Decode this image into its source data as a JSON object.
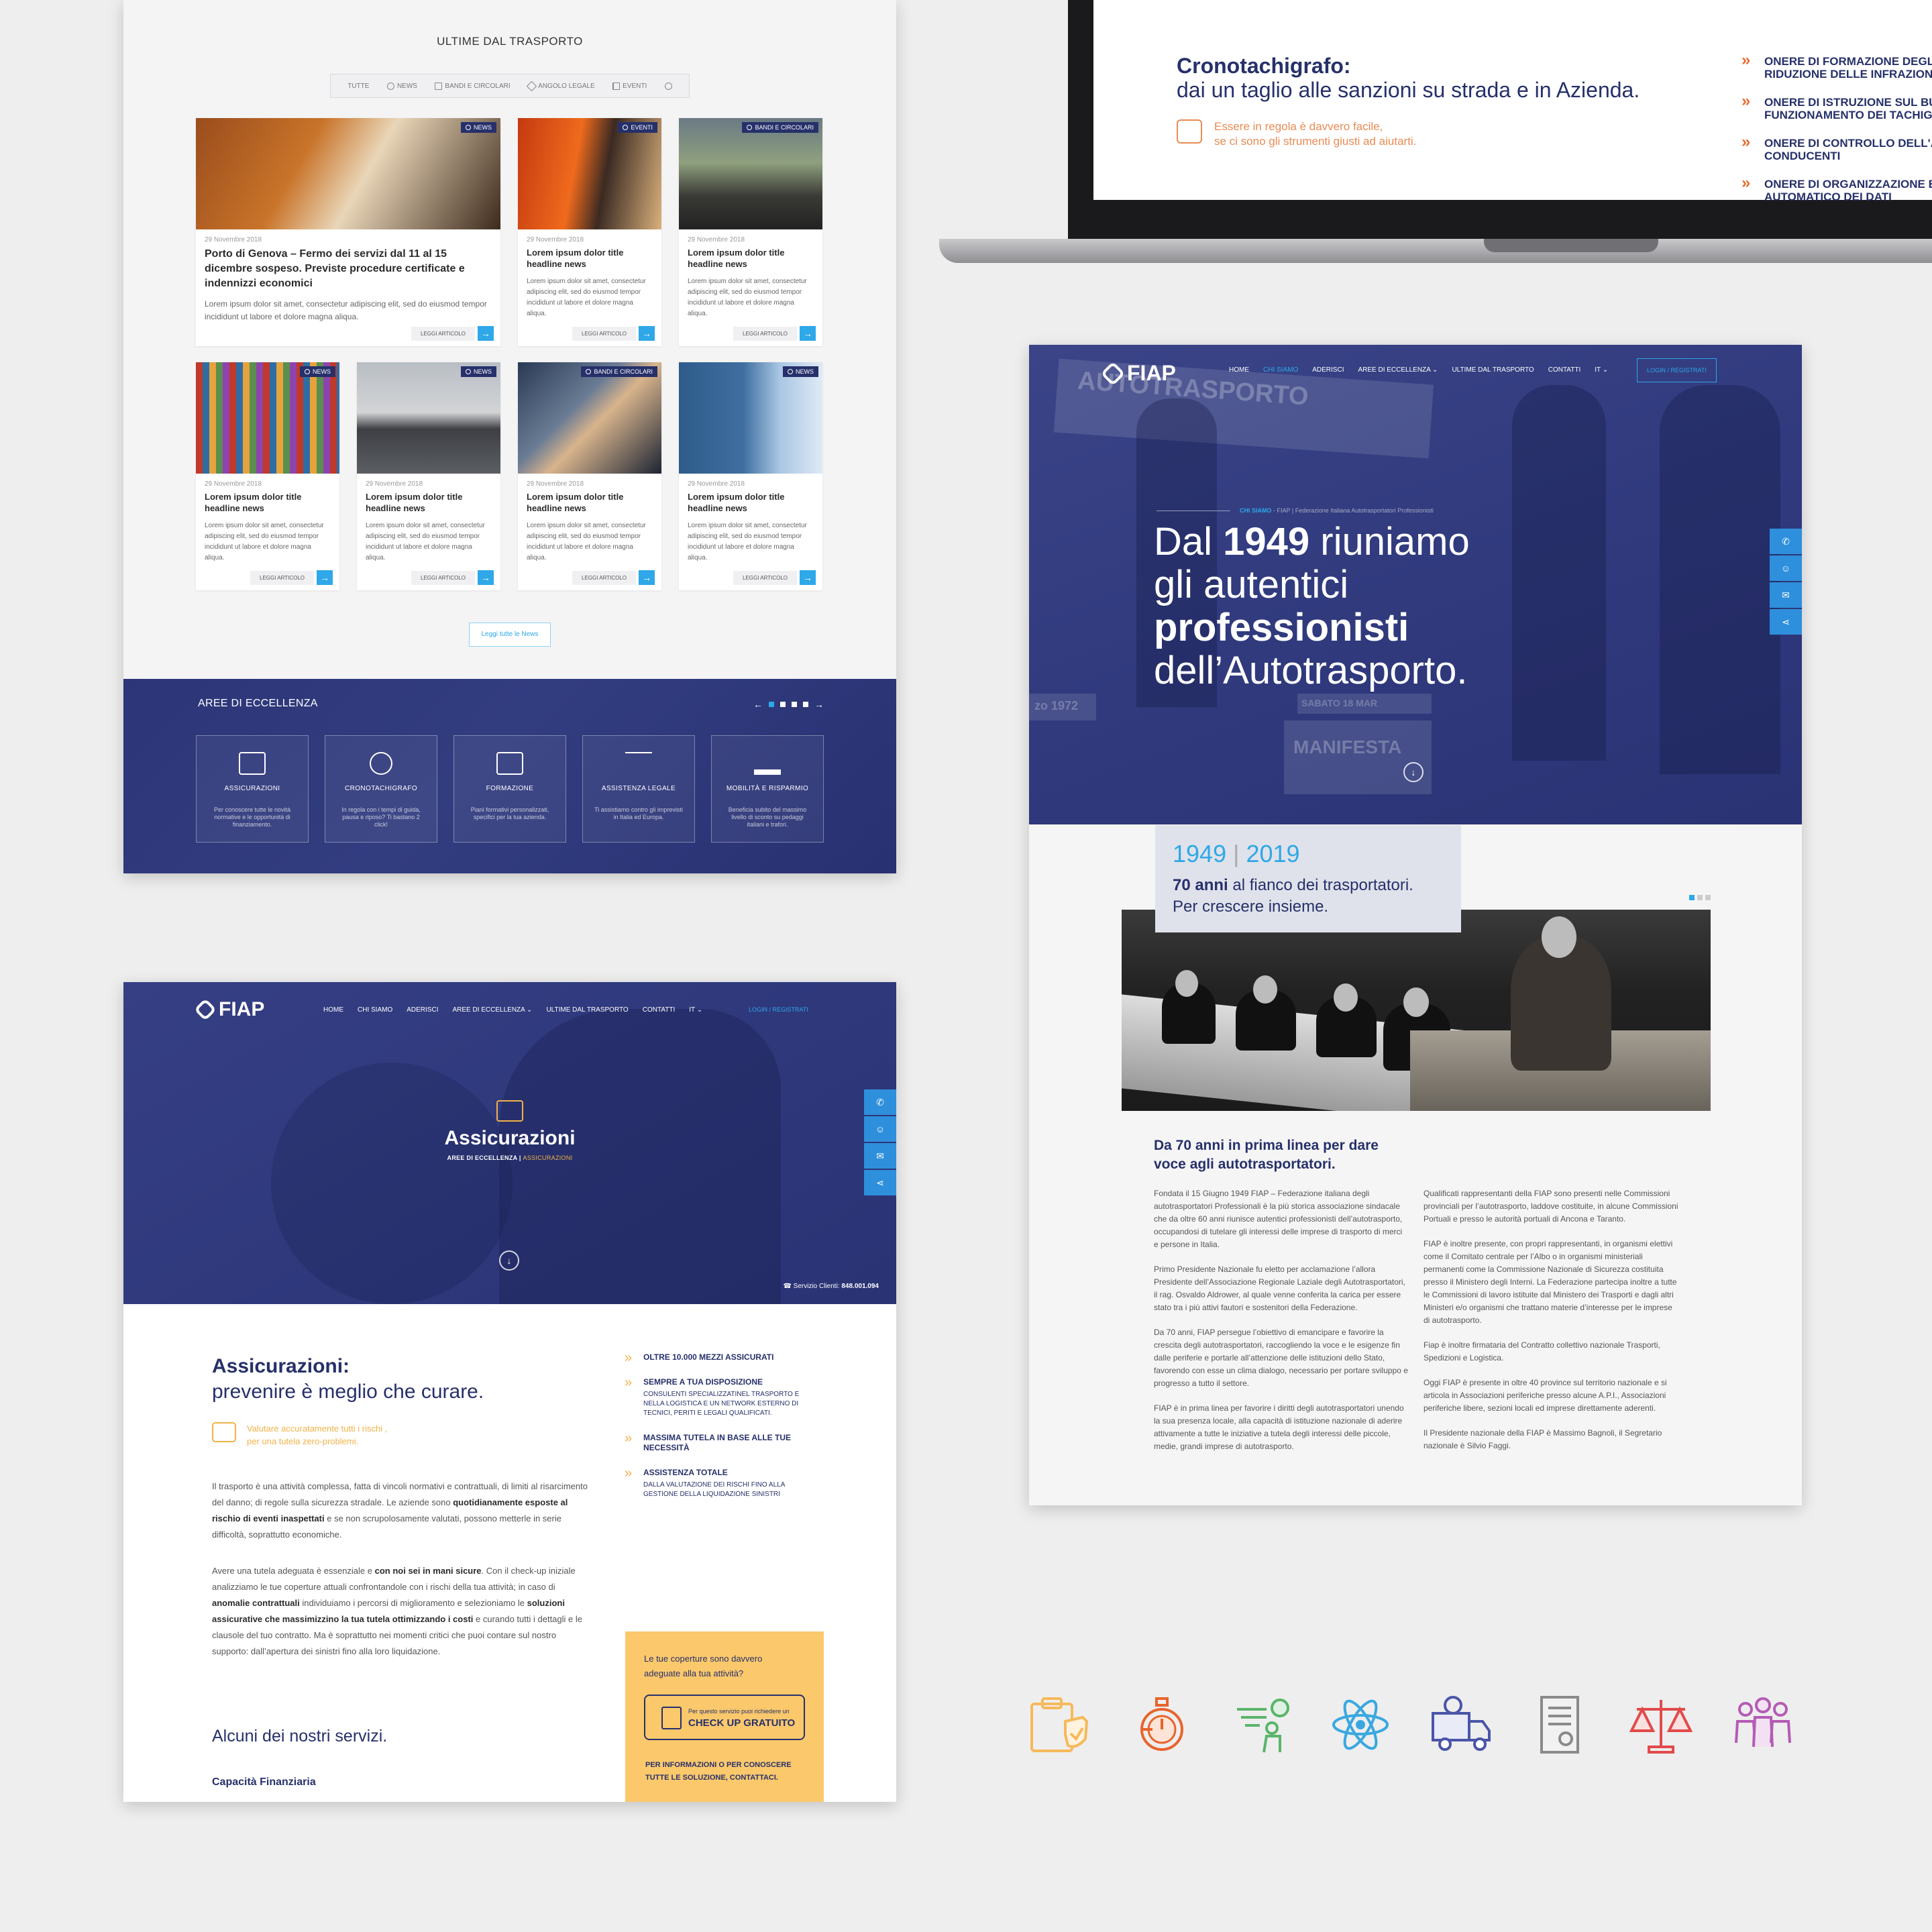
{
  "news": {
    "title": "ULTIME DAL TRASPORTO",
    "filters": [
      "TUTTE",
      "NEWS",
      "BANDI E CIRCOLARI",
      "ANGOLO LEGALE",
      "EVENTI"
    ],
    "cards": [
      {
        "tag": "NEWS",
        "date": "29 Novembre 2018",
        "title": "Porto di Genova – Fermo dei servizi dal 11 al 15 dicembre sospeso. Previste procedure certificate e indennizzi economici",
        "excerpt": "Lorem ipsum dolor sit amet, consectetur adipiscing elit, sed do eiusmod tempor incididunt ut labore et dolore magna aliqua.",
        "read": "LEGGI ARTICOLO"
      },
      {
        "tag": "EVENTI",
        "date": "29 Novembre 2018",
        "title": "Lorem ipsum dolor title headline news",
        "excerpt": "Lorem ipsum dolor sit amet, consectetur adipiscing elit, sed do eiusmod tempor incididunt ut labore et dolore magna aliqua.",
        "read": "LEGGI ARTICOLO"
      },
      {
        "tag": "BANDI E CIRCOLARI",
        "date": "29 Novembre 2018",
        "title": "Lorem ipsum dolor title headline news",
        "excerpt": "Lorem ipsum dolor sit amet, consectetur adipiscing elit, sed do eiusmod tempor incididunt ut labore et dolore magna aliqua.",
        "read": "LEGGI ARTICOLO"
      },
      {
        "tag": "NEWS",
        "date": "29 Novembre 2018",
        "title": "Lorem ipsum dolor title headline news",
        "excerpt": "Lorem ipsum dolor sit amet, consectetur adipiscing elit, sed do eiusmod tempor incididunt ut labore et dolore magna aliqua.",
        "read": "LEGGI ARTICOLO"
      },
      {
        "tag": "NEWS",
        "date": "29 Novembre 2018",
        "title": "Lorem ipsum dolor title headline news",
        "excerpt": "Lorem ipsum dolor sit amet, consectetur adipiscing elit, sed do eiusmod tempor incididunt ut labore et dolore magna aliqua.",
        "read": "LEGGI ARTICOLO"
      },
      {
        "tag": "BANDI E CIRCOLARI",
        "date": "29 Novembre 2018",
        "title": "Lorem ipsum dolor title headline news",
        "excerpt": "Lorem ipsum dolor sit amet, consectetur adipiscing elit, sed do eiusmod tempor incididunt ut labore et dolore magna aliqua.",
        "read": "LEGGI ARTICOLO"
      },
      {
        "tag": "NEWS",
        "date": "29 Novembre 2018",
        "title": "Lorem ipsum dolor title headline news",
        "excerpt": "Lorem ipsum dolor sit amet, consectetur adipiscing elit, sed do eiusmod tempor incididunt ut labore et dolore magna aliqua.",
        "read": "LEGGI ARTICOLO"
      }
    ],
    "all_news": "Leggi tutte le News"
  },
  "aree": {
    "title": "AREE DI ECCELLENZA",
    "prev": "←",
    "next": "→",
    "items": [
      {
        "name": "ASSICURAZIONI",
        "desc": "Per conoscere tutte le novità normative e le opportunità di finanziamento."
      },
      {
        "name": "CRONOTACHIGRAFO",
        "desc": "In regola con i tempi di guida, pausa e riposo? Ti bastano 2 click!"
      },
      {
        "name": "FORMAZIONE",
        "desc": "Piani formativi personalizzati, specifici per la tua azienda."
      },
      {
        "name": "ASSISTENZA LEGALE",
        "desc": "Ti assistiamo contro gli imprevisti in Italia ed Europa."
      },
      {
        "name": "MOBILITÀ E RISPARMIO",
        "desc": "Beneficia subito del massimo livello di sconto su pedaggi italiani e trafori."
      }
    ]
  },
  "crono": {
    "title": "Cronotachigrafo:",
    "subtitle": "dai un taglio alle sanzioni su strada e in Azienda.",
    "note_1": "Essere in regola è davvero facile,",
    "note_2": "se ci sono gli strumenti giusti ad aiutarti.",
    "oneri": [
      {
        "l1": "ONERE DI FORMAZIONE DEGLI A",
        "l2": "RIDUZIONE DELLE INFRAZIONI"
      },
      {
        "l1": "ONERE DI ISTRUZIONE SUL BUO",
        "l2": "FUNZIONAMENTO DEI TACHIGRA"
      },
      {
        "l1": "ONERE DI CONTROLLO DELL'ATT",
        "l2": "CONDUCENTI"
      },
      {
        "l1": "ONERE DI ORGANIZZAZIONE E S",
        "l2": "AUTOMATICO DEI DATI"
      }
    ]
  },
  "nav": {
    "logo": "FIAP",
    "links": [
      "HOME",
      "CHI SIAMO",
      "ADERISCI",
      "AREE DI ECCELLENZA ⌄",
      "ULTIME DAL TRASPORTO",
      "CONTATTI",
      "IT ⌄"
    ],
    "login": "LOGIN / REGISTRATI"
  },
  "chi": {
    "breadcrumb_on": "CHI SIAMO",
    "breadcrumb_rest": " - FIAP | Federazione Italiana Autotrasportatori Professionisti",
    "h_1a": "Dal ",
    "h_1b": "1949",
    "h_1c": " riuniamo",
    "h_2": "gli autentici",
    "h_3": "professionisti",
    "h_4": "dell’Autotrasporto.",
    "banner_1": "AUTOTRASPORTO",
    "banner_2": "MANIFESTA",
    "banner_3": "zo 1972",
    "banner_4": "SABATO 18 MAR",
    "year_a": "1949",
    "year_sep": "|",
    "year_b": "2019",
    "anni_bold": "70 anni",
    "anni_rest": " al fianco dei trasportatori.",
    "anni_2": "Per crescere insieme.",
    "h2_1": "Da 70 anni in prima linea per dare",
    "h2_2": "voce agli autotrasportatori.",
    "col1": [
      "Fondata il 15 Giugno 1949 FIAP – Federazione italiana degli autotrasportatori Professionali è la più storica associazione sindacale che da oltre 60 anni riunisce autentici professionisti dell’autotrasporto, occupandosi di tutelare gli interessi delle imprese di trasporto di merci e persone in Italia.",
      "Primo Presidente Nazionale fu eletto per acclamazione l’allora Presidente dell’Associazione Regionale Laziale degli Autotrasportatori, il rag. Osvaldo Aldrower, al quale venne conferita la carica per essere stato tra i più attivi fautori e sostenitori della Federazione.",
      "Da 70 anni, FIAP persegue l’obiettivo di emancipare e favorire la crescita degli autotrasportatori, raccogliendo la voce e le esigenze fin dalle periferie e portarle all’attenzione delle istituzioni dello Stato, favorendo con esse un clima dialogo, necessario per portare sviluppo e progresso a tutto il settore.",
      "FIAP è in prima linea per favorire i diritti degli autotrasportatori unendo la sua presenza locale, alla capacità di istituzione nazionale di aderire attivamente a tutte le iniziative a tutela degli interessi delle piccole, medie, grandi imprese di autotrasporto."
    ],
    "col2": [
      "Qualificati rappresentanti della FIAP sono presenti nelle Commissioni provinciali per l’autotrasporto, laddove costituite, in alcune Commissioni Portuali e presso le autorità portuali di Ancona e Taranto.",
      "FIAP è inoltre presente, con propri rappresentanti, in organismi elettivi come il Comitato centrale per l’Albo o in organismi ministeriali permanenti come la Commissione Nazionale di Sicurezza costituita presso il Ministero degli Interni. La Federazione partecipa inoltre a tutte le Commissioni di lavoro istituite dal Ministero dei Trasporti e dagli altri Ministeri e/o organismi che trattano materie d’interesse per le imprese di autotrasporto.",
      "Fiap è inoltre firmataria del Contratto collettivo nazionale Trasporti, Spedizioni e Logistica.",
      "Oggi FIAP è presente in oltre 40 province sul territorio nazionale e si articola in Associazioni periferiche presso alcune A.P.I., Associazioni periferiche libere, sezioni locali ed imprese direttamente aderenti.",
      "Il Presidente nazionale della FIAP è Massimo Bagnoli, il Segretario nazionale è Silvio Faggi."
    ]
  },
  "ass": {
    "title": "Assicurazioni",
    "bc_a": "AREE DI ECCELLENZA | ",
    "bc_b": "ASSICURAZIONI",
    "servizio_a": "Servizio Clienti: ",
    "servizio_b": "848.001.094",
    "h2_a": "Assicurazioni:",
    "h2_b": "prevenire è meglio che curare.",
    "note_1": "Valutare accuratamente tutti i rischi ,",
    "note_2": "per una tutela zero-problemi.",
    "p1_a": "Il trasporto è una attività complessa, fatta di vincoli normativi e contrattuali, di limiti al risarcimento del danno; di regole sulla sicurezza stradale. Le aziende sono ",
    "p1_b": "quotidianamente esposte al rischio di eventi inaspettati",
    "p1_c": " e se non scrupolosamente valutati, possono metterle in serie difficoltà, soprattutto economiche.",
    "p2_a": "Avere una tutela adeguata è essenziale e ",
    "p2_b": "con noi sei in mani sicure",
    "p2_c": ". Con il check-up iniziale analizziamo le tue coperture attuali confrontandole con i rischi della tua attività; in caso di ",
    "p2_d": "anomalie contrattuali",
    "p2_e": " individuiamo i percorsi di miglioramento e selezioniamo le ",
    "p2_f": "soluzioni assicurative che massimizzino la tua tutela ottimizzando i costi",
    "p2_g": " e curando tutti i dettagli e le clausole del tuo contratto. Ma è soprattutto nei momenti critici che puoi contare sul nostro supporto: dall’apertura dei sinistri fino alla loro liquidazione.",
    "list": [
      {
        "t": "OLTRE 10.000 MEZZI ASSICURATI",
        "d": ""
      },
      {
        "t": "SEMPRE A TUA DISPOSIZIONE",
        "d": "CONSULENTI SPECIALIZZATINEL TRASPORTO E NELLA LOGISTICA E UN NETWORK ESTERNO DI TECNICI, PERITI E LEGALI QUALIFICATI."
      },
      {
        "t": "MASSIMA TUTELA IN BASE ALLE TUE NECESSITÀ",
        "d": ""
      },
      {
        "t": "ASSISTENZA TOTALE",
        "d": "DALLA VALUTAZIONE DEI RISCHI FINO ALLA GESTIONE DELLA LIQUIDAZIONE SINISTRI"
      }
    ],
    "cta_q1": "Le tue coperture sono davvero",
    "cta_q2": "adeguate alla tua attività?",
    "cta_small": "Per questo servizio puoi richiedere un",
    "cta_big": "CHECK UP GRATUITO",
    "cta_info1": "PER INFORMAZIONI O PER CONOSCERE",
    "cta_info2": "TUTTE LE SOLUZIONE, CONTATTACI.",
    "h3": "Alcuni dei nostri servizi.",
    "h4": "Capacità Finanziaria"
  },
  "colors": {
    "navy": "#26306a",
    "blue": "#2ea8e8",
    "orange": "#e96c2f",
    "yellow": "#fbc86c"
  },
  "icon_row": [
    "insurance-shield-icon",
    "stopwatch-icon",
    "training-presenter-icon",
    "atom-icon",
    "delivery-truck-icon",
    "certificate-document-icon",
    "scales-justice-icon",
    "group-people-icon"
  ]
}
